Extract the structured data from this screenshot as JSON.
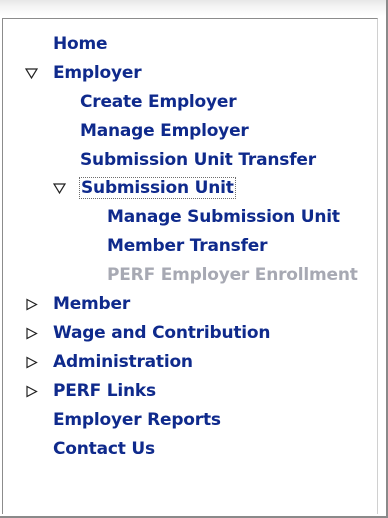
{
  "nav": {
    "home": "Home",
    "employer": {
      "label": "Employer",
      "expanded": true,
      "children": {
        "create_employer": "Create Employer",
        "manage_employer": "Manage Employer",
        "submission_unit_transfer": "Submission Unit Transfer",
        "submission_unit": {
          "label": "Submission Unit",
          "expanded": true,
          "children": {
            "manage_submission_unit": "Manage Submission Unit",
            "member_transfer": "Member Transfer",
            "perf_employer_enrollment": "PERF Employer Enrollment"
          }
        }
      }
    },
    "member": "Member",
    "wage_and_contribution": "Wage and Contribution",
    "administration": "Administration",
    "perf_links": "PERF Links",
    "employer_reports": "Employer Reports",
    "contact_us": "Contact Us"
  },
  "icons": {
    "expanded": "triangle-down-outline-icon",
    "collapsed": "triangle-right-outline-icon"
  },
  "colors": {
    "link": "#0f2a8c",
    "disabled": "#a7a9b3"
  }
}
